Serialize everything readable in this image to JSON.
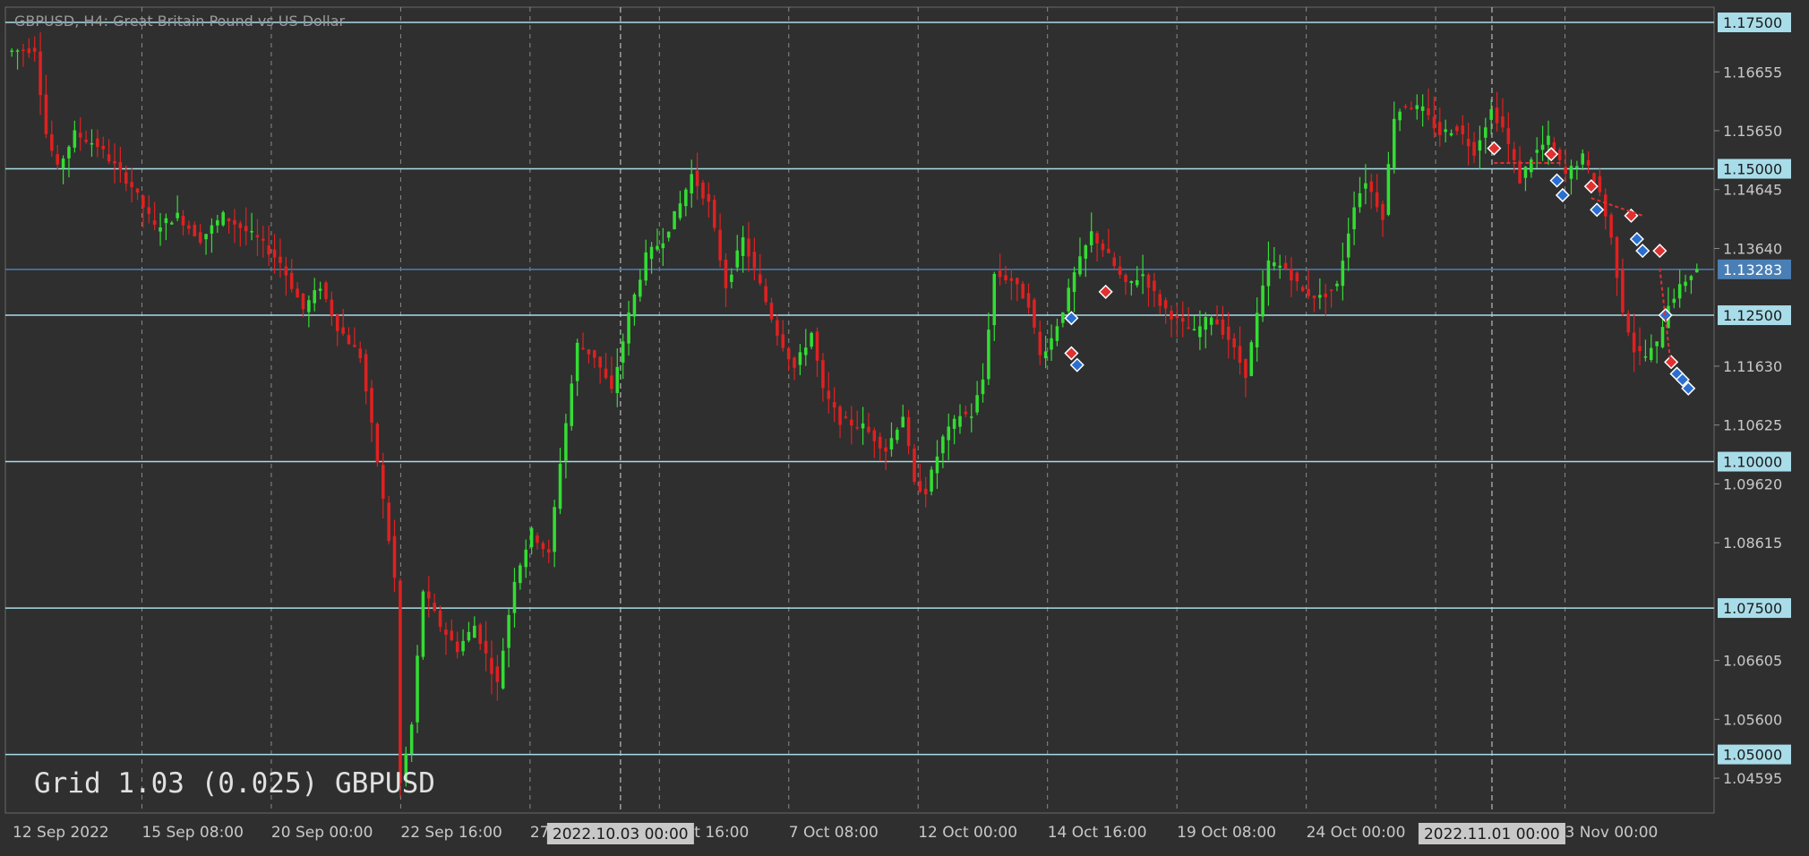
{
  "window": {
    "title": "GBPUSD, H4:  Great Britain Pound vs US Dollar",
    "watermark": "Grid 1.03 (0.025) GBPUSD"
  },
  "colors": {
    "background": "#2f2f2f",
    "bull": "#33dd33",
    "bear": "#e02020",
    "hline": "#a8dce8",
    "current_line": "#4a7fb5",
    "grid": "#8a8a8a",
    "axis_text": "#c8c8c8",
    "marker_blue": "#2a6fd0",
    "marker_red": "#e03030"
  },
  "chart_data": {
    "type": "candlestick",
    "symbol": "GBPUSD",
    "timeframe": "H4",
    "ylim": [
      1.04,
      1.1776
    ],
    "y_ticks": [
      "1.16655",
      "1.15650",
      "1.14645",
      "1.13640",
      "1.11630",
      "1.10625",
      "1.09620",
      "1.08615",
      "1.06605",
      "1.05600",
      "1.04595"
    ],
    "horizontal_lines": [
      "1.17500",
      "1.15000",
      "1.12500",
      "1.10000",
      "1.07500",
      "1.05000"
    ],
    "current_price": "1.13283",
    "x_labels": [
      "12 Sep 2022",
      "15 Sep 08:00",
      "20 Sep 00:00",
      "22 Sep 16:00",
      "27 Sep 08:00",
      "4 Oct 16:00",
      "7 Oct 08:00",
      "12 Oct 00:00",
      "14 Oct 16:00",
      "19 Oct 08:00",
      "24 Oct 00:00",
      "26 Oct 16:00",
      "3 Nov 00:00"
    ],
    "highlighted_dates": [
      "2022.10.03 00:00",
      "2022.11.01 00:00"
    ],
    "path_points": [
      [
        0,
        1.17
      ],
      [
        5,
        1.1705
      ],
      [
        7,
        1.156
      ],
      [
        9,
        1.15
      ],
      [
        12,
        1.156
      ],
      [
        16,
        1.154
      ],
      [
        22,
        1.147
      ],
      [
        26,
        1.14
      ],
      [
        30,
        1.142
      ],
      [
        34,
        1.138
      ],
      [
        38,
        1.142
      ],
      [
        44,
        1.138
      ],
      [
        48,
        1.134
      ],
      [
        52,
        1.126
      ],
      [
        55,
        1.13
      ],
      [
        58,
        1.123
      ],
      [
        62,
        1.118
      ],
      [
        65,
        1.1
      ],
      [
        68,
        1.08
      ],
      [
        69,
        1.045
      ],
      [
        71,
        1.055
      ],
      [
        73,
        1.078
      ],
      [
        76,
        1.072
      ],
      [
        79,
        1.068
      ],
      [
        82,
        1.072
      ],
      [
        86,
        1.062
      ],
      [
        89,
        1.08
      ],
      [
        92,
        1.088
      ],
      [
        95,
        1.084
      ],
      [
        97,
        1.1
      ],
      [
        100,
        1.12
      ],
      [
        103,
        1.118
      ],
      [
        106,
        1.112
      ],
      [
        109,
        1.125
      ],
      [
        112,
        1.135
      ],
      [
        115,
        1.138
      ],
      [
        118,
        1.144
      ],
      [
        120,
        1.149
      ],
      [
        123,
        1.144
      ],
      [
        126,
        1.13
      ],
      [
        129,
        1.138
      ],
      [
        132,
        1.13
      ],
      [
        135,
        1.122
      ],
      [
        138,
        1.116
      ],
      [
        141,
        1.122
      ],
      [
        143,
        1.112
      ],
      [
        146,
        1.107
      ],
      [
        150,
        1.106
      ],
      [
        154,
        1.102
      ],
      [
        157,
        1.108
      ],
      [
        159,
        1.096
      ],
      [
        161,
        1.095
      ],
      [
        164,
        1.104
      ],
      [
        167,
        1.108
      ],
      [
        169,
        1.108
      ],
      [
        171,
        1.114
      ],
      [
        173,
        1.132
      ],
      [
        176,
        1.131
      ],
      [
        179,
        1.127
      ],
      [
        181,
        1.118
      ],
      [
        183,
        1.121
      ],
      [
        185,
        1.126
      ],
      [
        187,
        1.132
      ],
      [
        190,
        1.139
      ],
      [
        193,
        1.135
      ],
      [
        196,
        1.13
      ],
      [
        199,
        1.132
      ],
      [
        202,
        1.127
      ],
      [
        205,
        1.124
      ],
      [
        208,
        1.122
      ],
      [
        211,
        1.125
      ],
      [
        214,
        1.121
      ],
      [
        217,
        1.115
      ],
      [
        219,
        1.125
      ],
      [
        221,
        1.134
      ],
      [
        224,
        1.133
      ],
      [
        227,
        1.129
      ],
      [
        230,
        1.128
      ],
      [
        233,
        1.13
      ],
      [
        236,
        1.144
      ],
      [
        238,
        1.148
      ],
      [
        241,
        1.142
      ],
      [
        243,
        1.159
      ],
      [
        245,
        1.161
      ],
      [
        248,
        1.16
      ],
      [
        251,
        1.156
      ],
      [
        254,
        1.157
      ],
      [
        257,
        1.153
      ],
      [
        260,
        1.16
      ],
      [
        262,
        1.157
      ],
      [
        265,
        1.148
      ],
      [
        267,
        1.152
      ],
      [
        270,
        1.155
      ],
      [
        273,
        1.149
      ],
      [
        276,
        1.152
      ],
      [
        279,
        1.146
      ],
      [
        281,
        1.138
      ],
      [
        283,
        1.126
      ],
      [
        285,
        1.119
      ],
      [
        287,
        1.118
      ],
      [
        289,
        1.12
      ],
      [
        291,
        1.127
      ],
      [
        294,
        1.131
      ],
      [
        296,
        1.133
      ]
    ]
  }
}
